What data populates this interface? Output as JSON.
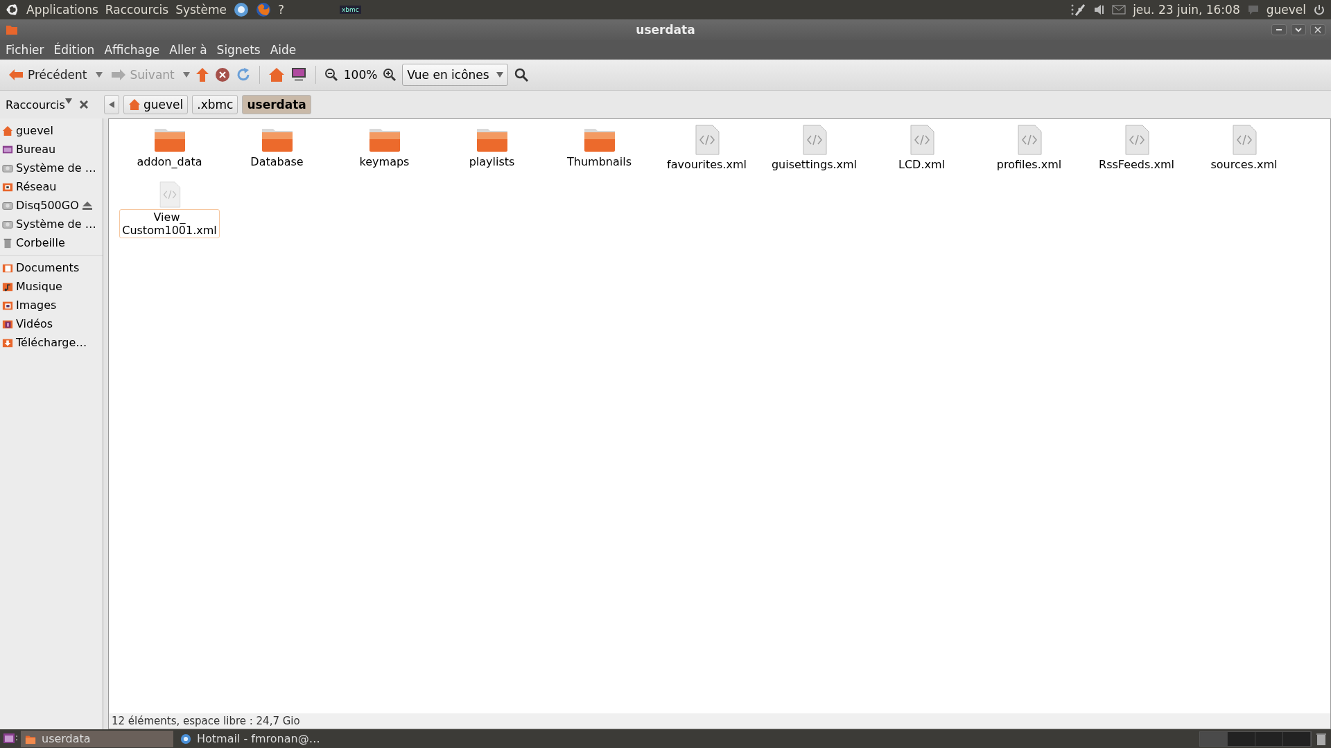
{
  "top_panel": {
    "menus": [
      "Applications",
      "Raccourcis",
      "Système"
    ],
    "launchers": [
      {
        "kind": "browser"
      },
      {
        "kind": "firefox"
      },
      {
        "kind": "help",
        "label": "?"
      }
    ],
    "tray_logo": "xbmc",
    "clock": "jeu. 23 juin, 16:08",
    "user": "guevel"
  },
  "window": {
    "title": "userdata"
  },
  "menu_bar": [
    "Fichier",
    "Édition",
    "Affichage",
    "Aller à",
    "Signets",
    "Aide"
  ],
  "toolbar": {
    "back": {
      "label": "Précédent",
      "disabled": false
    },
    "forward": {
      "label": "Suivant",
      "disabled": true
    },
    "zoom": "100%",
    "view": "Vue en icônes"
  },
  "location": {
    "sidebar_title": "Raccourcis",
    "crumbs": [
      {
        "label": "guevel",
        "kind": "home",
        "selected": false
      },
      {
        "label": ".xbmc",
        "kind": "folder",
        "selected": false
      },
      {
        "label": "userdata",
        "kind": "folder",
        "selected": true
      }
    ]
  },
  "sidebar": {
    "groups": [
      [
        {
          "label": "guevel",
          "kind": "home",
          "eject": false
        },
        {
          "label": "Bureau",
          "kind": "desktop",
          "eject": false
        },
        {
          "label": "Système de …",
          "kind": "drive",
          "eject": false
        },
        {
          "label": "Réseau",
          "kind": "network",
          "eject": false
        },
        {
          "label": "Disq500GO",
          "kind": "drive",
          "eject": true
        },
        {
          "label": "Système de …",
          "kind": "drive",
          "eject": false
        },
        {
          "label": "Corbeille",
          "kind": "trash",
          "eject": false
        }
      ],
      [
        {
          "label": "Documents",
          "kind": "documents",
          "eject": false
        },
        {
          "label": "Musique",
          "kind": "music",
          "eject": false
        },
        {
          "label": "Images",
          "kind": "pictures",
          "eject": false
        },
        {
          "label": "Vidéos",
          "kind": "videos",
          "eject": false
        },
        {
          "label": "Télécharge…",
          "kind": "downloads",
          "eject": false
        }
      ]
    ]
  },
  "files": [
    {
      "name": "addon_data",
      "kind": "folder",
      "selected": false
    },
    {
      "name": "Database",
      "kind": "folder",
      "selected": false
    },
    {
      "name": "keymaps",
      "kind": "folder",
      "selected": false
    },
    {
      "name": "playlists",
      "kind": "folder",
      "selected": false
    },
    {
      "name": "Thumbnails",
      "kind": "folder",
      "selected": false
    },
    {
      "name": "favourites.xml",
      "kind": "xml",
      "selected": false
    },
    {
      "name": "guisettings.xml",
      "kind": "xml",
      "selected": false
    },
    {
      "name": "LCD.xml",
      "kind": "xml",
      "selected": false
    },
    {
      "name": "profiles.xml",
      "kind": "xml",
      "selected": false
    },
    {
      "name": "RssFeeds.xml",
      "kind": "xml",
      "selected": false
    },
    {
      "name": "sources.xml",
      "kind": "xml",
      "selected": false
    },
    {
      "name": "View_ Custom1001.xml",
      "kind": "xml",
      "selected": true
    }
  ],
  "status_bar": "12 éléments, espace libre : 24,7 Gio",
  "taskbar": {
    "tasks": [
      {
        "label": "userdata",
        "kind": "folder",
        "selected": true
      },
      {
        "label": "Hotmail - fmronan@…",
        "kind": "browser",
        "selected": false
      }
    ]
  }
}
